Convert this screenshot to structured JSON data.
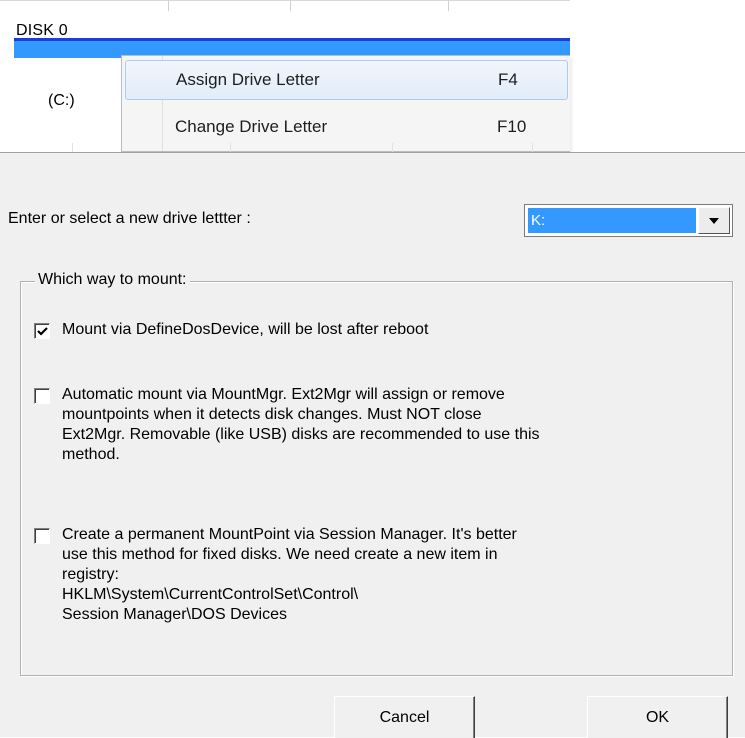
{
  "disk_list": {
    "disk_name": "DISK 0",
    "volume_label": "(C:)"
  },
  "context_menu": {
    "items": [
      {
        "label": "Assign Drive Letter",
        "shortcut": "F4",
        "highlighted": true
      },
      {
        "label": "Change Drive Letter",
        "shortcut": "F10",
        "highlighted": false
      }
    ]
  },
  "dialog": {
    "prompt": "Enter or select a new drive lettter :",
    "drive_letter": {
      "selected": "K:"
    },
    "group_title": "Which way to mount:",
    "options": [
      {
        "text": "Mount via DefineDosDevice, will be lost after reboot",
        "checked": true
      },
      {
        "text": "Automatic mount via MountMgr. Ext2Mgr will assign or remove\nmountpoints when it detects disk changes. Must NOT close\nExt2Mgr. Removable (like USB) disks are recommended to use this\nmethod.",
        "checked": false
      },
      {
        "text": "Create a permanent MountPoint via Session Manager. It's better\nuse this method for fixed disks. We need create a new item in\nregistry:\nHKLM\\System\\CurrentControlSet\\Control\\\nSession Manager\\DOS Devices",
        "checked": false
      }
    ],
    "cancel_label": "Cancel",
    "ok_label": "OK"
  },
  "colors": {
    "selection": "#3399ff",
    "selection_rule": "#1a3fd6",
    "dialog_bg": "#f0f0f0",
    "menu_highlight_border": "#aecbed"
  },
  "icons": [
    "checkbox-checked-icon",
    "checkbox-unchecked-icon",
    "dropdown-arrow-icon"
  ]
}
